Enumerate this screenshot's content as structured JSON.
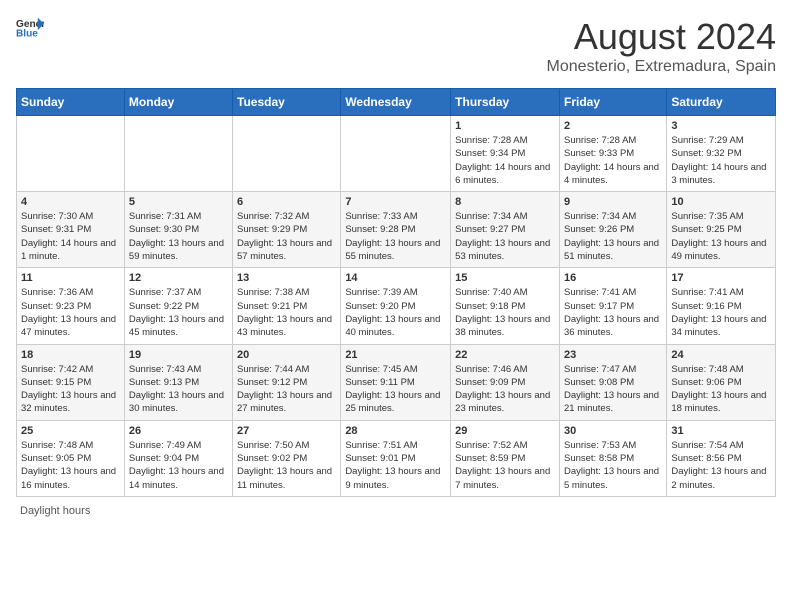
{
  "header": {
    "logo_general": "General",
    "logo_blue": "Blue",
    "month_title": "August 2024",
    "location": "Monesterio, Extremadura, Spain"
  },
  "footer": {
    "label": "Daylight hours"
  },
  "days_header": [
    "Sunday",
    "Monday",
    "Tuesday",
    "Wednesday",
    "Thursday",
    "Friday",
    "Saturday"
  ],
  "weeks": [
    [
      {
        "day": "",
        "info": ""
      },
      {
        "day": "",
        "info": ""
      },
      {
        "day": "",
        "info": ""
      },
      {
        "day": "",
        "info": ""
      },
      {
        "day": "1",
        "info": "Sunrise: 7:28 AM\nSunset: 9:34 PM\nDaylight: 14 hours and 6 minutes."
      },
      {
        "day": "2",
        "info": "Sunrise: 7:28 AM\nSunset: 9:33 PM\nDaylight: 14 hours and 4 minutes."
      },
      {
        "day": "3",
        "info": "Sunrise: 7:29 AM\nSunset: 9:32 PM\nDaylight: 14 hours and 3 minutes."
      }
    ],
    [
      {
        "day": "4",
        "info": "Sunrise: 7:30 AM\nSunset: 9:31 PM\nDaylight: 14 hours and 1 minute."
      },
      {
        "day": "5",
        "info": "Sunrise: 7:31 AM\nSunset: 9:30 PM\nDaylight: 13 hours and 59 minutes."
      },
      {
        "day": "6",
        "info": "Sunrise: 7:32 AM\nSunset: 9:29 PM\nDaylight: 13 hours and 57 minutes."
      },
      {
        "day": "7",
        "info": "Sunrise: 7:33 AM\nSunset: 9:28 PM\nDaylight: 13 hours and 55 minutes."
      },
      {
        "day": "8",
        "info": "Sunrise: 7:34 AM\nSunset: 9:27 PM\nDaylight: 13 hours and 53 minutes."
      },
      {
        "day": "9",
        "info": "Sunrise: 7:34 AM\nSunset: 9:26 PM\nDaylight: 13 hours and 51 minutes."
      },
      {
        "day": "10",
        "info": "Sunrise: 7:35 AM\nSunset: 9:25 PM\nDaylight: 13 hours and 49 minutes."
      }
    ],
    [
      {
        "day": "11",
        "info": "Sunrise: 7:36 AM\nSunset: 9:23 PM\nDaylight: 13 hours and 47 minutes."
      },
      {
        "day": "12",
        "info": "Sunrise: 7:37 AM\nSunset: 9:22 PM\nDaylight: 13 hours and 45 minutes."
      },
      {
        "day": "13",
        "info": "Sunrise: 7:38 AM\nSunset: 9:21 PM\nDaylight: 13 hours and 43 minutes."
      },
      {
        "day": "14",
        "info": "Sunrise: 7:39 AM\nSunset: 9:20 PM\nDaylight: 13 hours and 40 minutes."
      },
      {
        "day": "15",
        "info": "Sunrise: 7:40 AM\nSunset: 9:18 PM\nDaylight: 13 hours and 38 minutes."
      },
      {
        "day": "16",
        "info": "Sunrise: 7:41 AM\nSunset: 9:17 PM\nDaylight: 13 hours and 36 minutes."
      },
      {
        "day": "17",
        "info": "Sunrise: 7:41 AM\nSunset: 9:16 PM\nDaylight: 13 hours and 34 minutes."
      }
    ],
    [
      {
        "day": "18",
        "info": "Sunrise: 7:42 AM\nSunset: 9:15 PM\nDaylight: 13 hours and 32 minutes."
      },
      {
        "day": "19",
        "info": "Sunrise: 7:43 AM\nSunset: 9:13 PM\nDaylight: 13 hours and 30 minutes."
      },
      {
        "day": "20",
        "info": "Sunrise: 7:44 AM\nSunset: 9:12 PM\nDaylight: 13 hours and 27 minutes."
      },
      {
        "day": "21",
        "info": "Sunrise: 7:45 AM\nSunset: 9:11 PM\nDaylight: 13 hours and 25 minutes."
      },
      {
        "day": "22",
        "info": "Sunrise: 7:46 AM\nSunset: 9:09 PM\nDaylight: 13 hours and 23 minutes."
      },
      {
        "day": "23",
        "info": "Sunrise: 7:47 AM\nSunset: 9:08 PM\nDaylight: 13 hours and 21 minutes."
      },
      {
        "day": "24",
        "info": "Sunrise: 7:48 AM\nSunset: 9:06 PM\nDaylight: 13 hours and 18 minutes."
      }
    ],
    [
      {
        "day": "25",
        "info": "Sunrise: 7:48 AM\nSunset: 9:05 PM\nDaylight: 13 hours and 16 minutes."
      },
      {
        "day": "26",
        "info": "Sunrise: 7:49 AM\nSunset: 9:04 PM\nDaylight: 13 hours and 14 minutes."
      },
      {
        "day": "27",
        "info": "Sunrise: 7:50 AM\nSunset: 9:02 PM\nDaylight: 13 hours and 11 minutes."
      },
      {
        "day": "28",
        "info": "Sunrise: 7:51 AM\nSunset: 9:01 PM\nDaylight: 13 hours and 9 minutes."
      },
      {
        "day": "29",
        "info": "Sunrise: 7:52 AM\nSunset: 8:59 PM\nDaylight: 13 hours and 7 minutes."
      },
      {
        "day": "30",
        "info": "Sunrise: 7:53 AM\nSunset: 8:58 PM\nDaylight: 13 hours and 5 minutes."
      },
      {
        "day": "31",
        "info": "Sunrise: 7:54 AM\nSunset: 8:56 PM\nDaylight: 13 hours and 2 minutes."
      }
    ]
  ]
}
